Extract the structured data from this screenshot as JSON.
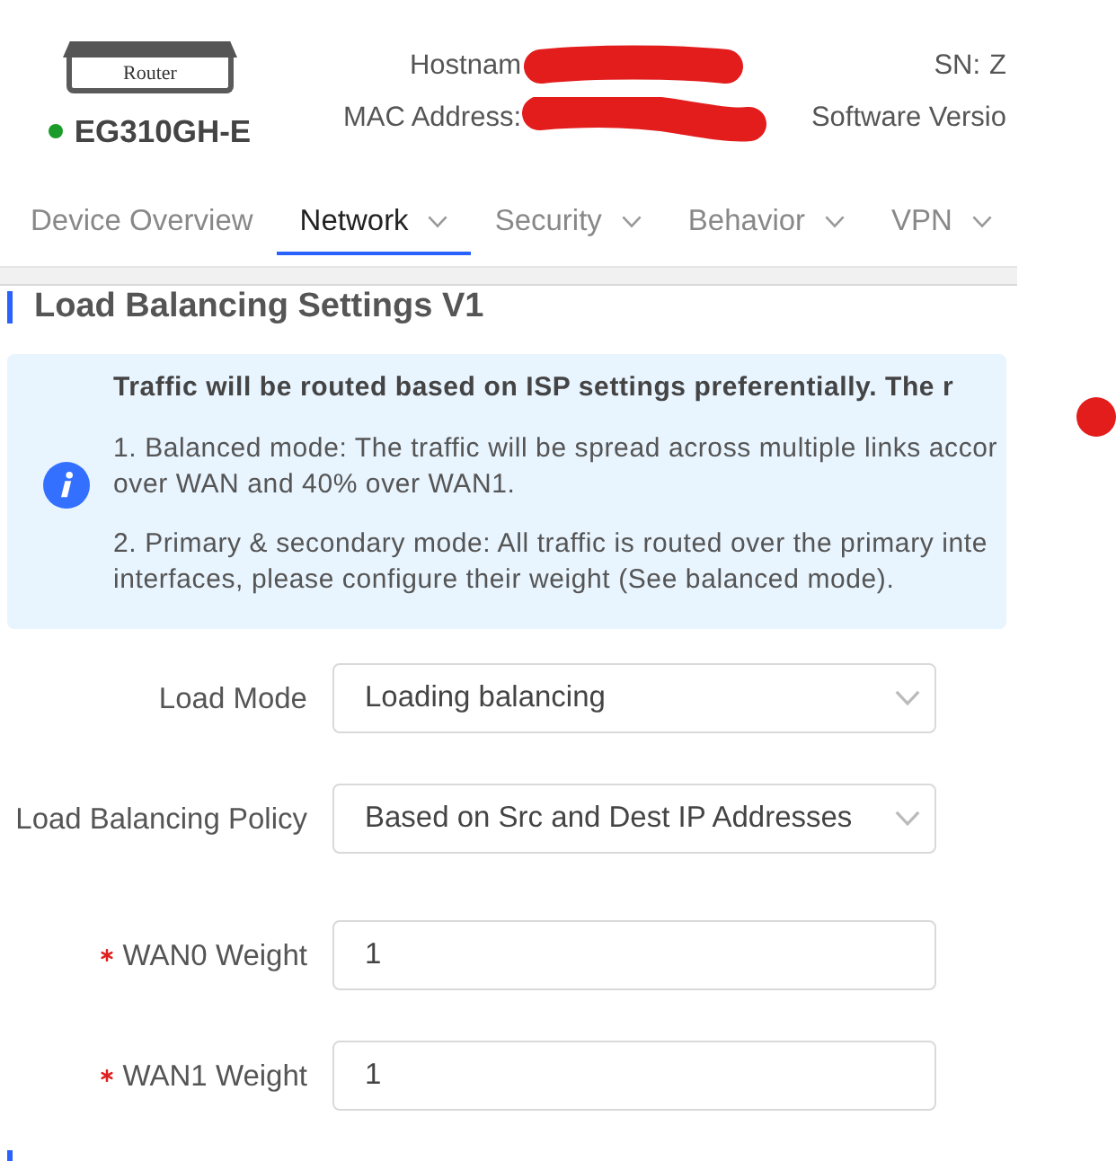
{
  "device": {
    "image_label": "Router",
    "model": "EG310GH-E",
    "online": true
  },
  "device_info": [
    {
      "left": {
        "label": "Hostnam",
        "redacted": true
      },
      "right": {
        "label": "SN:",
        "value": "Z"
      }
    },
    {
      "left": {
        "label": "MAC Address:",
        "redacted": true
      },
      "right": {
        "label": "Software Versio"
      }
    }
  ],
  "nav_tabs": [
    {
      "label": "Device Overview",
      "selected": false,
      "has_menu": false
    },
    {
      "label": "Network",
      "selected": true,
      "has_menu": true
    },
    {
      "label": "Security",
      "selected": false,
      "has_menu": true
    },
    {
      "label": "Behavior",
      "selected": false,
      "has_menu": true
    },
    {
      "label": "VPN",
      "selected": false,
      "has_menu": true
    }
  ],
  "section_title": "Load Balancing Settings V1",
  "notice": {
    "heading": "Traffic will be routed based on ISP settings preferentially. The r",
    "paragraphs": [
      {
        "lines": [
          "1. Balanced mode: The traffic will be spread across multiple links accor",
          "over WAN and 40% over WAN1."
        ]
      },
      {
        "lines": [
          "2. Primary & secondary mode: All traffic is routed over the primary inte",
          "interfaces, please configure their weight (See balanced mode)."
        ]
      }
    ]
  },
  "form": {
    "fields": [
      {
        "label": "Load Mode",
        "kind": "select",
        "value": "Loading balancing",
        "required": false
      },
      {
        "label": "Load Balancing Policy",
        "kind": "select",
        "value": "Based on Src and Dest IP Addresses",
        "required": false
      },
      {
        "label": "WAN0 Weight",
        "kind": "input",
        "value": "1",
        "required": true
      },
      {
        "label": "WAN1 Weight",
        "kind": "input",
        "value": "1",
        "required": true
      }
    ]
  }
}
